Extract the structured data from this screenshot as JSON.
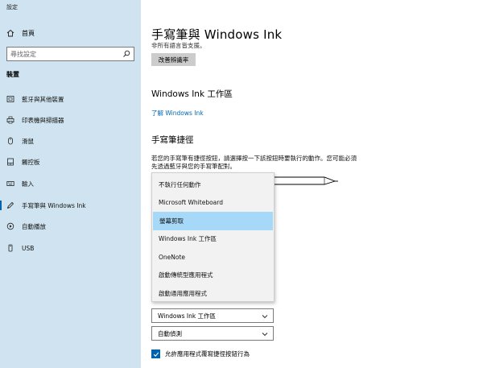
{
  "window": {
    "title": "設定"
  },
  "sidebar": {
    "home_label": "首頁",
    "search_placeholder": "尋找設定",
    "section_label": "裝置",
    "items": [
      {
        "label": "藍牙與其他裝置",
        "icon": "bluetooth-icon"
      },
      {
        "label": "印表機與掃描器",
        "icon": "printer-icon"
      },
      {
        "label": "滑鼠",
        "icon": "mouse-icon"
      },
      {
        "label": "觸控板",
        "icon": "touchpad-icon"
      },
      {
        "label": "輸入",
        "icon": "keyboard-icon"
      },
      {
        "label": "手寫筆與 Windows Ink",
        "icon": "pen-icon"
      },
      {
        "label": "自動播放",
        "icon": "autoplay-icon"
      },
      {
        "label": "USB",
        "icon": "usb-icon"
      }
    ]
  },
  "main": {
    "title": "手寫筆與 Windows Ink",
    "subnote": "非所有語言皆支援。",
    "improve_button": "改善辨識率",
    "ink_heading": "Windows Ink 工作區",
    "learn_link": "了解 Windows Ink",
    "shortcut_heading": "手寫筆捷徑",
    "shortcut_desc": "若您的手寫筆有捷徑按鈕，請選擇按一下該按鈕時要執行的動作。您可能必須先透過藍牙與您的手寫筆配對。",
    "dropdown_options": [
      "不執行任何動作",
      "Microsoft Whiteboard",
      "螢幕剪取",
      "Windows Ink 工作區",
      "OneNote",
      "啟動傳統型應用程式",
      "啟動通用應用程式"
    ],
    "selected_option": "螢幕剪取",
    "combo1_value": "Windows Ink 工作區",
    "combo2_value": "自動偵測",
    "checkbox_label": "允許應用程式覆寫捷徑按鈕行為",
    "checkbox_checked": true
  },
  "colors": {
    "sidebar_bg": "#cfe4f0",
    "accent": "#0063b1",
    "selected_bg": "#a6d8f8"
  }
}
